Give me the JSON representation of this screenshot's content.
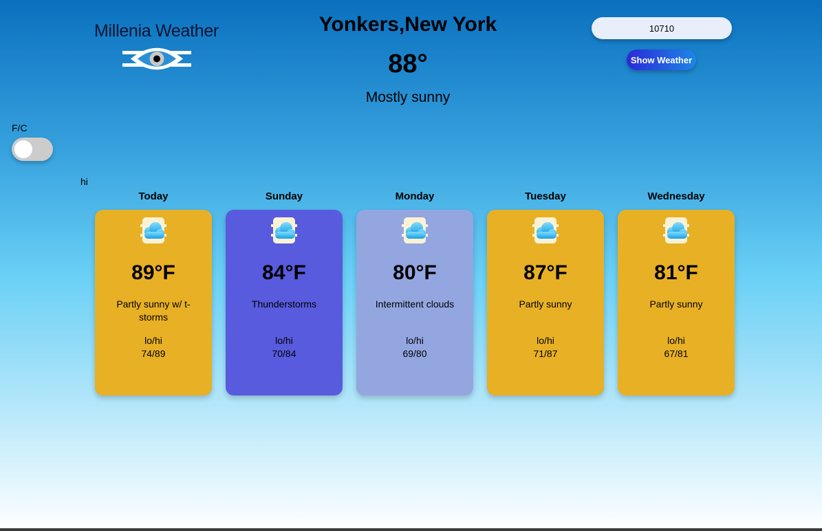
{
  "logo": {
    "title": "Millenia Weather",
    "icon": "eye-icon"
  },
  "header": {
    "city": "Yonkers,New York",
    "temperature": "88°",
    "condition": "Mostly sunny"
  },
  "search": {
    "zip_value": "10710",
    "button_label": "Show Weather"
  },
  "units_toggle": {
    "label": "F/C",
    "state": "off"
  },
  "debug_text": "hi",
  "colors": {
    "sunny_card": "#e8b024",
    "storm_card": "#585bdd",
    "cloud_card": "#94a6e0",
    "button_start": "#2a2ad8",
    "button_end": "#1d86e6"
  },
  "forecast": [
    {
      "day": "Today",
      "temp": "89°F",
      "condition": "Partly sunny w/ t-storms",
      "lohi_label": "lo/hi",
      "lohi": "74/89",
      "icon": "sun-behind-cloud-icon",
      "color": "#e8b024"
    },
    {
      "day": "Sunday",
      "temp": "84°F",
      "condition": "Thunderstorms",
      "lohi_label": "lo/hi",
      "lohi": "70/84",
      "icon": "sun-behind-cloud-icon",
      "color": "#585bdd"
    },
    {
      "day": "Monday",
      "temp": "80°F",
      "condition": "Intermittent clouds",
      "lohi_label": "lo/hi",
      "lohi": "69/80",
      "icon": "sun-behind-cloud-icon",
      "color": "#94a6e0"
    },
    {
      "day": "Tuesday",
      "temp": "87°F",
      "condition": "Partly sunny",
      "lohi_label": "lo/hi",
      "lohi": "71/87",
      "icon": "sun-behind-cloud-icon",
      "color": "#e8b024"
    },
    {
      "day": "Wednesday",
      "temp": "81°F",
      "condition": "Partly sunny",
      "lohi_label": "lo/hi",
      "lohi": "67/81",
      "icon": "sun-behind-cloud-icon",
      "color": "#e8b024"
    }
  ]
}
